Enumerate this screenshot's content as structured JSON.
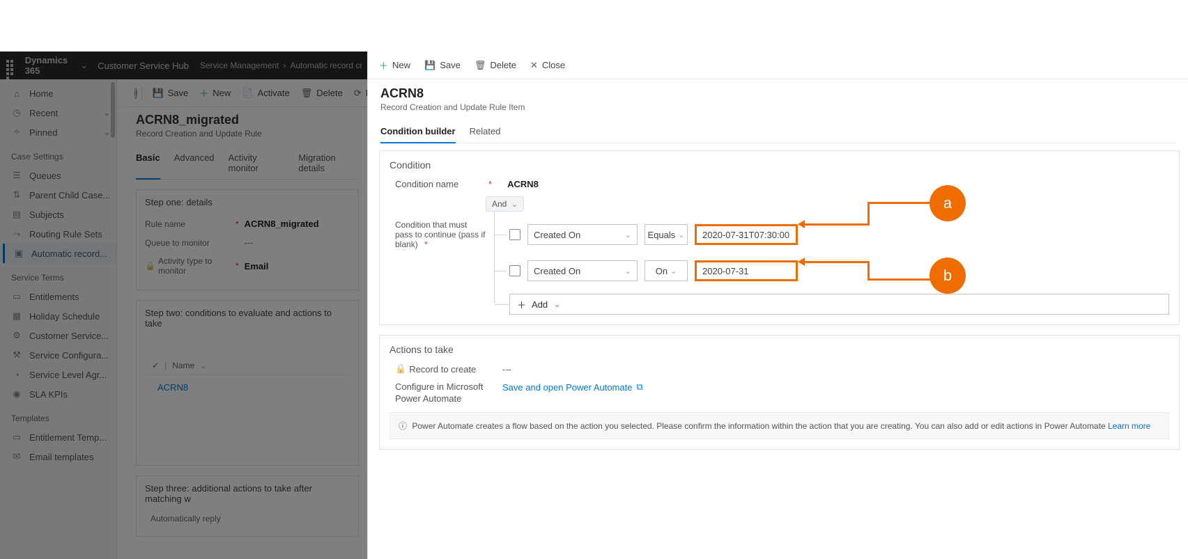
{
  "topnav": {
    "brand": "Dynamics 365",
    "hub": "Customer Service Hub",
    "breadcrumb": [
      "Service Management",
      "Automatic record creation"
    ]
  },
  "left_cmd": {
    "save": "Save",
    "new": "New",
    "activate": "Activate",
    "delete": "Delete",
    "refresh": "Refr"
  },
  "sidebar": {
    "items_top": [
      {
        "label": "Home",
        "icon": "home"
      },
      {
        "label": "Recent",
        "icon": "clock",
        "chev": true
      },
      {
        "label": "Pinned",
        "icon": "pin",
        "chev": true
      }
    ],
    "group1_title": "Case Settings",
    "group1": [
      {
        "label": "Queues"
      },
      {
        "label": "Parent Child Case..."
      },
      {
        "label": "Subjects"
      },
      {
        "label": "Routing Rule Sets"
      },
      {
        "label": "Automatic record...",
        "active": true
      }
    ],
    "group2_title": "Service Terms",
    "group2": [
      {
        "label": "Entitlements"
      },
      {
        "label": "Holiday Schedule"
      },
      {
        "label": "Customer Service..."
      },
      {
        "label": "Service Configura..."
      },
      {
        "label": "Service Level Agr..."
      },
      {
        "label": "SLA KPIs"
      }
    ],
    "group3_title": "Templates",
    "group3": [
      {
        "label": "Entitlement Temp..."
      },
      {
        "label": "Email templates"
      }
    ]
  },
  "record": {
    "title": "ACRN8_migrated",
    "subtitle": "Record Creation and Update Rule",
    "tabs": [
      "Basic",
      "Advanced",
      "Activity monitor",
      "Migration details"
    ],
    "step1": {
      "title": "Step one: details",
      "rule_name_label": "Rule name",
      "rule_name_value": "ACRN8_migrated",
      "queue_label": "Queue to monitor",
      "queue_value": "---",
      "activity_label": "Activity type to monitor",
      "activity_value": "Email"
    },
    "step2": {
      "title": "Step two: conditions to evaluate and actions to take",
      "col": "Name",
      "row1": "ACRN8"
    },
    "step3": {
      "title": "Step three: additional actions to take after matching w",
      "line1": "Automatically reply"
    }
  },
  "panel": {
    "cmd": {
      "new": "New",
      "save": "Save",
      "delete": "Delete",
      "close": "Close"
    },
    "title": "ACRN8",
    "subtitle": "Record Creation and Update Rule Item",
    "tabs": [
      "Condition builder",
      "Related"
    ],
    "condition": {
      "section_title": "Condition",
      "name_label": "Condition name",
      "name_value": "ACRN8",
      "that_must_label": "Condition that must pass to continue (pass if blank)",
      "and_chip": "And",
      "rows": [
        {
          "attr": "Created On",
          "op": "Equals",
          "value": "2020-07-31T07:30:00"
        },
        {
          "attr": "Created On",
          "op": "On",
          "value": "2020-07-31"
        }
      ],
      "add_label": "Add"
    },
    "actions": {
      "section_title": "Actions to take",
      "record_label": "Record to create",
      "record_value": "---",
      "configure_label": "Configure in Microsoft Power Automate",
      "link_text": "Save and open Power Automate",
      "banner_text": "Power Automate creates a flow based on the action you selected. Please confirm the information within the action that you are creating. You can also add or edit actions in Power Automate",
      "learn_more": "Learn more"
    }
  },
  "callouts": {
    "a": "a",
    "b": "b"
  }
}
